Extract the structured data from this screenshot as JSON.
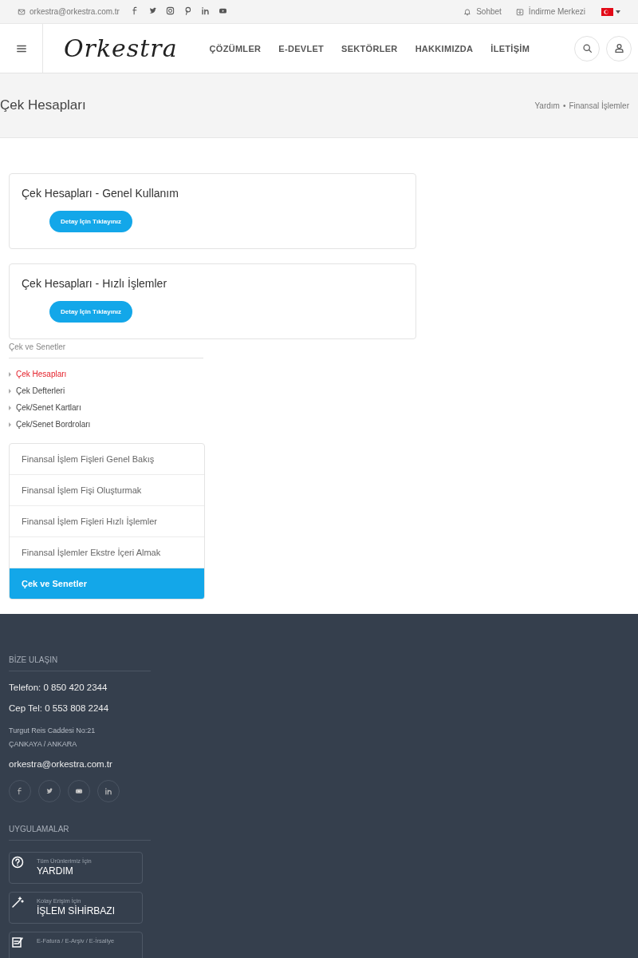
{
  "topbar": {
    "email": "orkestra@orkestra.com.tr",
    "links": [
      {
        "kind": "chat",
        "label": "Sohbet"
      },
      {
        "kind": "download",
        "label": "İndirme Merkezi"
      }
    ]
  },
  "header": {
    "logo": "Orkestra",
    "nav": [
      "ÇÖZÜMLER",
      "E-DEVLET",
      "SEKTÖRLER",
      "HAKKIMIZDA",
      "İLETİŞİM"
    ]
  },
  "page_title": "Çek Hesapları",
  "breadcrumb": {
    "items": [
      "Yardım",
      "Finansal İşlemler"
    ],
    "separator": "•"
  },
  "cards": [
    {
      "title": "Çek Hesapları - Genel Kullanım",
      "button": "Detay İçin Tıklayınız"
    },
    {
      "title": "Çek Hesapları - Hızlı İşlemler",
      "button": "Detay İçin Tıklayınız"
    }
  ],
  "category": {
    "title": "Çek ve Senetler",
    "links": [
      {
        "label": "Çek Hesapları",
        "selected": true
      },
      {
        "label": "Çek Defterleri",
        "selected": false
      },
      {
        "label": "Çek/Senet Kartları",
        "selected": false
      },
      {
        "label": "Çek/Senet Bordroları",
        "selected": false
      }
    ]
  },
  "menu": [
    {
      "label": "Finansal İşlem Fişleri Genel Bakış",
      "selected": false
    },
    {
      "label": "Finansal İşlem Fişi Oluşturmak",
      "selected": false
    },
    {
      "label": "Finansal İşlem Fişleri Hızlı İşlemler",
      "selected": false
    },
    {
      "label": "Finansal İşlemler Ekstre İçeri Almak",
      "selected": false
    },
    {
      "label": "Çek ve Senetler",
      "selected": true
    }
  ],
  "footer": {
    "contact_heading": "BİZE ULAŞIN",
    "phone": "Telefon: 0 850 420 2344",
    "mobile": "Cep Tel: 0 553 808 2244",
    "address": [
      "Turgut Reis Caddesi No:21",
      "ÇANKAYA / ANKARA"
    ],
    "email": "orkestra@orkestra.com.tr",
    "apps_heading": "UYGULAMALAR",
    "apps": [
      {
        "kind": "help",
        "caption": "Tüm Ürünlerimiz İçin",
        "title": "YARDIM"
      },
      {
        "kind": "wand",
        "caption": "Kolay Erişim İçin",
        "title": "İŞLEM SİHİRBAZI"
      },
      {
        "kind": "invoice",
        "caption": "E-Fatura / E-Arşiv / E-İrsaliye"
      }
    ]
  }
}
